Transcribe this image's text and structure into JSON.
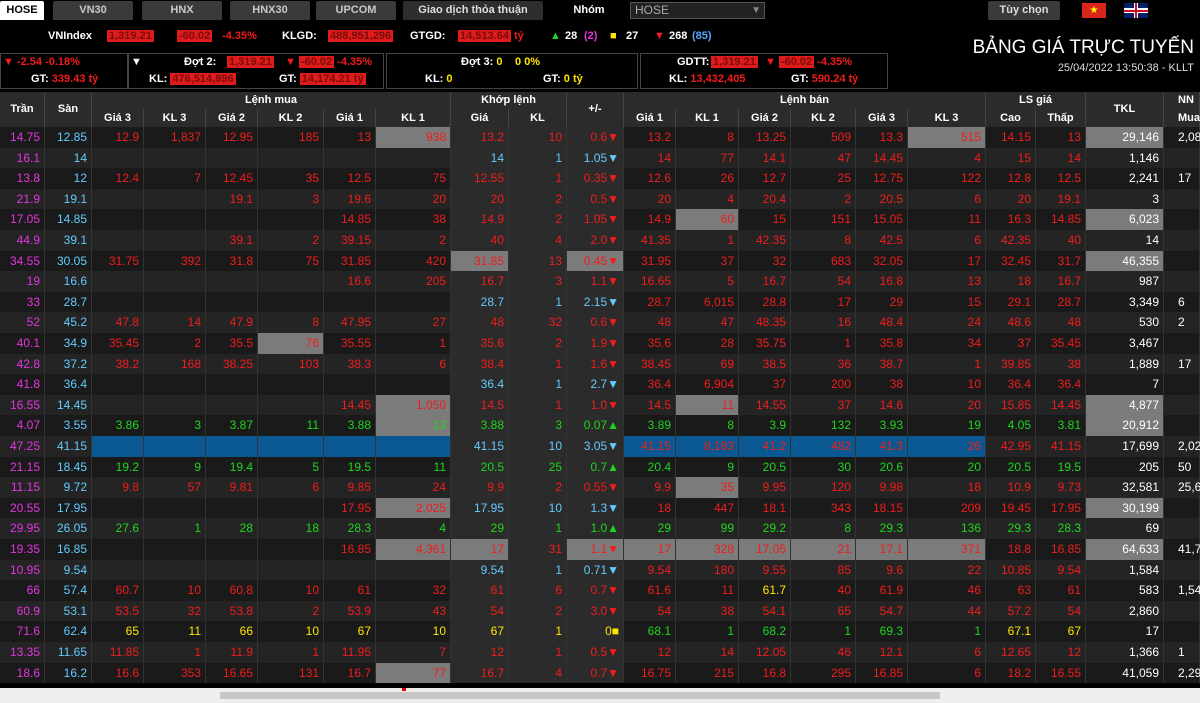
{
  "tabs": [
    "HOSE",
    "VN30",
    "HNX",
    "HNX30",
    "UPCOM",
    "Giao dịch thỏa thuận",
    "Nhóm"
  ],
  "select_value": "HOSE",
  "tuychon": "Tùy chọn",
  "index": {
    "name": "VNIndex",
    "value": "1,319.21",
    "change": "-60.02",
    "pct": "-4.35%",
    "klgd_label": "KLGD:",
    "klgd": "488,951,296",
    "gtgd_label": "GTGD:",
    "gtgd": "14,513.64",
    "unit": "tỷ",
    "up": "28",
    "ce": "2",
    "ref": "27",
    "down": "268",
    "floor": "85",
    "sub_change": "-2.54",
    "sub_pct": "-0.18%",
    "gt_label": "GT:",
    "gt": "339.43 tỷ"
  },
  "dot2": {
    "label": "Đợt 2:",
    "value": "1,319.21",
    "change": "-60.02",
    "pct": "-4.35%",
    "kl_label": "KL:",
    "kl": "476,514,896",
    "gt_label": "GT:",
    "gt": "14,174.21 tỷ"
  },
  "dot3": {
    "label": "Đợt 3:",
    "value": "0",
    "change": "0",
    "pct": "0%",
    "kl_label": "KL:",
    "kl": "0",
    "gt_label": "GT:",
    "gt": "0 tỷ"
  },
  "gdtt": {
    "label": "GDTT:",
    "value": "1,319.21",
    "change": "-60.02",
    "pct": "-4.35%",
    "kl_label": "KL:",
    "kl": "13,432,405",
    "gt_label": "GT:",
    "gt": "590.24 tỷ"
  },
  "title": "BẢNG GIÁ TRỰC TUYẾN",
  "datetime": "25/04/2022 13:50:38 - KLLT",
  "headers": {
    "tran": "Trần",
    "san": "Sàn",
    "lenh_mua": "Lệnh mua",
    "gia3": "Giá 3",
    "kl3": "KL 3",
    "gia2": "Giá 2",
    "kl2": "KL 2",
    "gia1": "Giá 1",
    "kl1": "KL 1",
    "khop": "Khớp lệnh",
    "gia": "Giá",
    "kl": "KL",
    "pm": "+/-",
    "lenh_ban": "Lệnh bán",
    "ls": "LS giá",
    "cao": "Cao",
    "thap": "Thấp",
    "tkl": "TKL",
    "nn": "NN",
    "mua": "Mua"
  },
  "rows": [
    [
      "14.75",
      "12.85",
      "12.9",
      "1,837",
      "12.95",
      "185",
      "13",
      "938",
      "13.2",
      "10",
      "0.6▼",
      "13.2",
      "8",
      "13.25",
      "509",
      "13.3",
      "515",
      "14.15",
      "13",
      "29,146",
      "2,08"
    ],
    [
      "16.1",
      "14",
      "",
      "",
      "",
      "",
      "",
      "",
      "14",
      "1",
      "1.05▼",
      "14",
      "77",
      "14.1",
      "47",
      "14.45",
      "4",
      "15",
      "14",
      "1,146",
      ""
    ],
    [
      "13.8",
      "12",
      "12.4",
      "7",
      "12.45",
      "35",
      "12.5",
      "75",
      "12.55",
      "1",
      "0.35▼",
      "12.6",
      "26",
      "12.7",
      "25",
      "12.75",
      "122",
      "12.8",
      "12.5",
      "2,241",
      "17"
    ],
    [
      "21.9",
      "19.1",
      "",
      "",
      "19.1",
      "3",
      "19.6",
      "20",
      "20",
      "2",
      "0.5▼",
      "20",
      "4",
      "20.4",
      "2",
      "20.5",
      "6",
      "20",
      "19.1",
      "3",
      ""
    ],
    [
      "17.05",
      "14.85",
      "",
      "",
      "",
      "",
      "14.85",
      "38",
      "14.9",
      "2",
      "1.05▼",
      "14.9",
      "60",
      "15",
      "151",
      "15.05",
      "11",
      "16.3",
      "14.85",
      "6,023",
      ""
    ],
    [
      "44.9",
      "39.1",
      "",
      "",
      "39.1",
      "2",
      "39.15",
      "2",
      "40",
      "4",
      "2.0▼",
      "41.35",
      "1",
      "42.35",
      "8",
      "42.5",
      "6",
      "42.35",
      "40",
      "14",
      ""
    ],
    [
      "34.55",
      "30.05",
      "31.75",
      "392",
      "31.8",
      "75",
      "31.85",
      "420",
      "31.85",
      "13",
      "0.45▼",
      "31.95",
      "37",
      "32",
      "683",
      "32.05",
      "17",
      "32.45",
      "31.7",
      "46,355",
      ""
    ],
    [
      "19",
      "16.6",
      "",
      "",
      "",
      "",
      "16.6",
      "205",
      "16.7",
      "3",
      "1.1▼",
      "16.65",
      "5",
      "16.7",
      "54",
      "16.8",
      "13",
      "18",
      "16.7",
      "987",
      ""
    ],
    [
      "33",
      "28.7",
      "",
      "",
      "",
      "",
      "",
      "",
      "28.7",
      "1",
      "2.15▼",
      "28.7",
      "6,015",
      "28.8",
      "17",
      "29",
      "15",
      "29.1",
      "28.7",
      "3,349",
      "6"
    ],
    [
      "52",
      "45.2",
      "47.8",
      "14",
      "47.9",
      "8",
      "47.95",
      "27",
      "48",
      "32",
      "0.6▼",
      "48",
      "47",
      "48.35",
      "16",
      "48.4",
      "24",
      "48.6",
      "48",
      "530",
      "2"
    ],
    [
      "40.1",
      "34.9",
      "35.45",
      "2",
      "35.5",
      "76",
      "35.55",
      "1",
      "35.6",
      "2",
      "1.9▼",
      "35.6",
      "28",
      "35.75",
      "1",
      "35.8",
      "34",
      "37",
      "35.45",
      "3,467",
      ""
    ],
    [
      "42.8",
      "37.2",
      "38.2",
      "168",
      "38.25",
      "103",
      "38.3",
      "6",
      "38.4",
      "1",
      "1.6▼",
      "38.45",
      "69",
      "38.5",
      "36",
      "38.7",
      "1",
      "39.85",
      "38",
      "1,889",
      "17"
    ],
    [
      "41.8",
      "36.4",
      "",
      "",
      "",
      "",
      "",
      "",
      "36.4",
      "1",
      "2.7▼",
      "36.4",
      "6,904",
      "37",
      "200",
      "38",
      "10",
      "36.4",
      "36.4",
      "7",
      ""
    ],
    [
      "16.55",
      "14.45",
      "",
      "",
      "",
      "",
      "14.45",
      "1,050",
      "14.5",
      "1",
      "1.0▼",
      "14.5",
      "11",
      "14.55",
      "37",
      "14.6",
      "20",
      "15.85",
      "14.45",
      "4,877",
      ""
    ],
    [
      "4.07",
      "3.55",
      "3.86",
      "3",
      "3.87",
      "11",
      "3.88",
      "13",
      "3.88",
      "3",
      "0.07▲",
      "3.89",
      "8",
      "3.9",
      "132",
      "3.93",
      "19",
      "4.05",
      "3.81",
      "20,912",
      ""
    ],
    [
      "47.25",
      "41.15",
      "",
      "",
      "",
      "",
      "",
      "",
      "41.15",
      "10",
      "3.05▼",
      "41.15",
      "8,183",
      "41.2",
      "482",
      "41.3",
      "26",
      "42.95",
      "41.15",
      "17,699",
      "2,02"
    ],
    [
      "21.15",
      "18.45",
      "19.2",
      "9",
      "19.4",
      "5",
      "19.5",
      "11",
      "20.5",
      "25",
      "0.7▲",
      "20.4",
      "9",
      "20.5",
      "30",
      "20.6",
      "20",
      "20.5",
      "19.5",
      "205",
      "50"
    ],
    [
      "11.15",
      "9.72",
      "9.8",
      "57",
      "9.81",
      "6",
      "9.85",
      "24",
      "9.9",
      "2",
      "0.55▼",
      "9.9",
      "35",
      "9.95",
      "120",
      "9.98",
      "18",
      "10.9",
      "9.73",
      "32,581",
      "25,61"
    ],
    [
      "20.55",
      "17.95",
      "",
      "",
      "",
      "",
      "17.95",
      "2,025",
      "17.95",
      "10",
      "1.3▼",
      "18",
      "447",
      "18.1",
      "343",
      "18.15",
      "209",
      "19.45",
      "17.95",
      "30,199",
      ""
    ],
    [
      "29.95",
      "26.05",
      "27.6",
      "1",
      "28",
      "18",
      "28.3",
      "4",
      "29",
      "1",
      "1.0▲",
      "29",
      "99",
      "29.2",
      "8",
      "29.3",
      "136",
      "29.3",
      "28.3",
      "69",
      ""
    ],
    [
      "19.35",
      "16.85",
      "",
      "",
      "",
      "",
      "16.85",
      "4,361",
      "17",
      "31",
      "1.1▼",
      "17",
      "328",
      "17.05",
      "21",
      "17.1",
      "371",
      "18.8",
      "16.85",
      "64,633",
      "41,79"
    ],
    [
      "10.95",
      "9.54",
      "",
      "",
      "",
      "",
      "",
      "",
      "9.54",
      "1",
      "0.71▼",
      "9.54",
      "180",
      "9.55",
      "85",
      "9.6",
      "22",
      "10.85",
      "9.54",
      "1,584",
      ""
    ],
    [
      "66",
      "57.4",
      "60.7",
      "10",
      "60.8",
      "10",
      "61",
      "32",
      "61",
      "6",
      "0.7▼",
      "61.6",
      "11",
      "61.7",
      "40",
      "61.9",
      "46",
      "63",
      "61",
      "583",
      "1,54"
    ],
    [
      "60.9",
      "53.1",
      "53.5",
      "32",
      "53.8",
      "2",
      "53.9",
      "43",
      "54",
      "2",
      "3.0▼",
      "54",
      "38",
      "54.1",
      "65",
      "54.7",
      "44",
      "57.2",
      "54",
      "2,860",
      ""
    ],
    [
      "71.6",
      "62.4",
      "65",
      "11",
      "66",
      "10",
      "67",
      "10",
      "67",
      "1",
      "0■",
      "68.1",
      "1",
      "68.2",
      "1",
      "69.3",
      "1",
      "67.1",
      "67",
      "17",
      ""
    ],
    [
      "13.35",
      "11.65",
      "11.85",
      "1",
      "11.9",
      "1",
      "11.95",
      "7",
      "12",
      "1",
      "0.5▼",
      "12",
      "14",
      "12.05",
      "46",
      "12.1",
      "6",
      "12.65",
      "12",
      "1,366",
      "1"
    ],
    [
      "18.6",
      "16.2",
      "16.6",
      "353",
      "16.65",
      "131",
      "16.7",
      "77",
      "16.7",
      "4",
      "0.7▼",
      "16.75",
      "215",
      "16.8",
      "295",
      "16.85",
      "6",
      "18.2",
      "16.55",
      "41,059",
      "2,29"
    ]
  ]
}
